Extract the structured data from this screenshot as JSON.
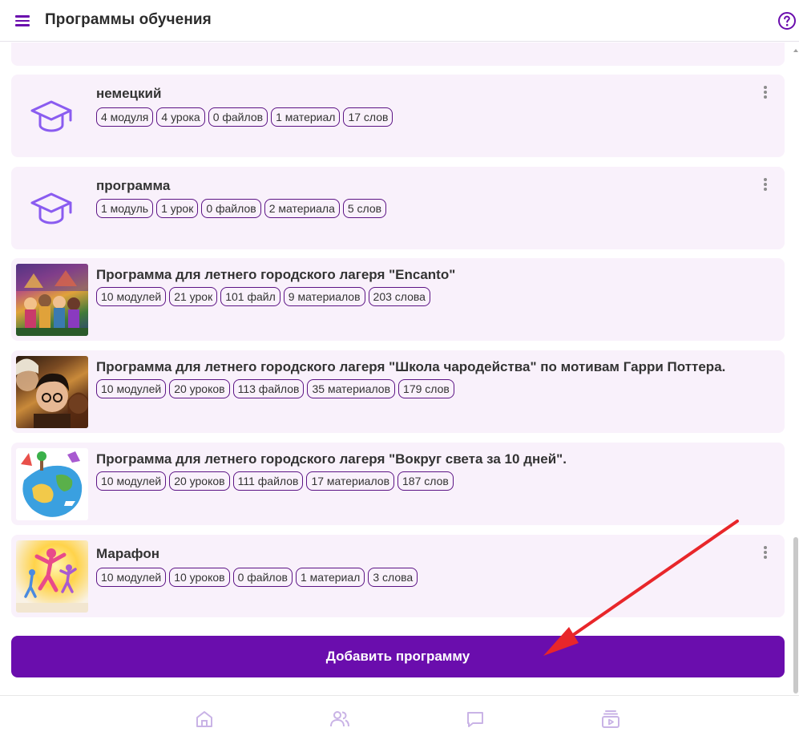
{
  "header": {
    "title": "Программы обучения",
    "menu_icon": "hamburger-menu-icon",
    "help_icon": "question-circle-icon"
  },
  "colors": {
    "accent": "#6a0dad",
    "card_bg": "#f9f1fb",
    "tag_border": "#5c1485",
    "annotation_arrow": "#e8262a"
  },
  "programs": [
    {
      "title": "немецкий",
      "thumbnail": "graduation-cap-icon",
      "tags": [
        "4 модуля",
        "4 урока",
        "0 файлов",
        "1 материал",
        "17 слов"
      ],
      "has_menu": true
    },
    {
      "title": "программа",
      "thumbnail": "graduation-cap-icon",
      "tags": [
        "1 модуль",
        "1 урок",
        "0 файлов",
        "2 материала",
        "5 слов"
      ],
      "has_menu": true
    },
    {
      "title": "Программа для летнего городского лагеря \"Encanto\"",
      "thumbnail": "encanto-image",
      "tags": [
        "10 модулей",
        "21 урок",
        "101 файл",
        "9 материалов",
        "203 слова"
      ],
      "has_menu": false
    },
    {
      "title": "Программа для летнего городского лагеря \"Школа чародейства\" по мотивам Гарри Поттера.",
      "thumbnail": "harry-potter-image",
      "tags": [
        "10 модулей",
        "20 уроков",
        "113 файлов",
        "35 материалов",
        "179 слов"
      ],
      "has_menu": false
    },
    {
      "title": "Программа для летнего городского лагеря \"Вокруг света за 10 дней\".",
      "thumbnail": "world-travel-image",
      "tags": [
        "10 модулей",
        "20 уроков",
        "111 файлов",
        "17 материалов",
        "187 слов"
      ],
      "has_menu": false
    },
    {
      "title": "Марафон",
      "thumbnail": "marathon-image",
      "tags": [
        "10 модулей",
        "10 уроков",
        "0 файлов",
        "1 материал",
        "3 слова"
      ],
      "has_menu": true
    }
  ],
  "actions": {
    "add_program_label": "Добавить программу"
  },
  "bottom_nav": [
    {
      "icon": "home-icon"
    },
    {
      "icon": "users-icon"
    },
    {
      "icon": "chat-icon"
    },
    {
      "icon": "video-library-icon"
    }
  ]
}
